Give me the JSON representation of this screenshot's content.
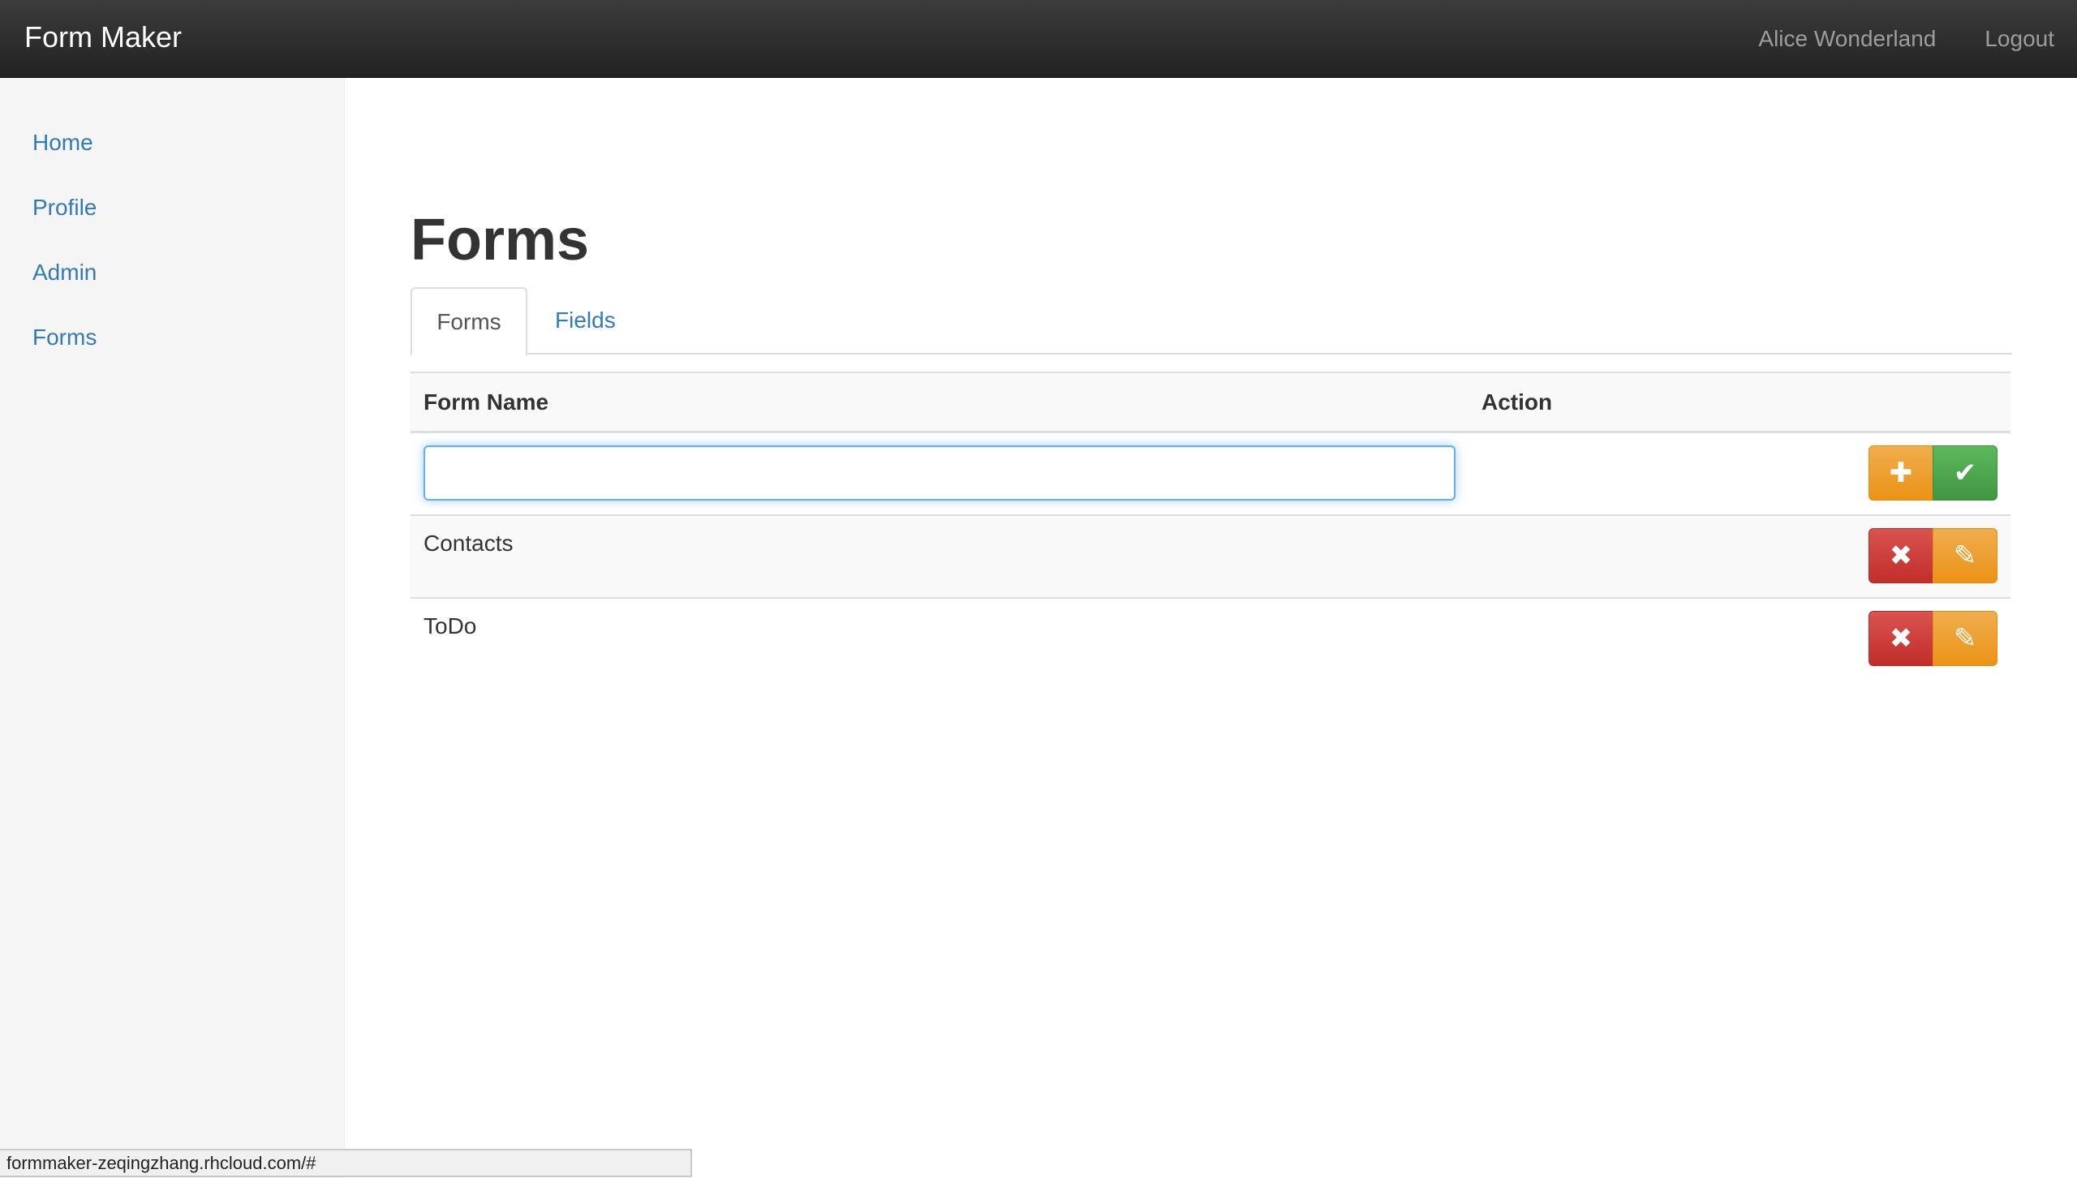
{
  "navbar": {
    "brand": "Form Maker",
    "user": "Alice Wonderland",
    "logout": "Logout"
  },
  "sidebar": {
    "items": [
      {
        "label": "Home"
      },
      {
        "label": "Profile"
      },
      {
        "label": "Admin"
      },
      {
        "label": "Forms"
      }
    ]
  },
  "main": {
    "title": "Forms",
    "tabs": [
      {
        "label": "Forms",
        "active": true
      },
      {
        "label": "Fields",
        "active": false
      }
    ],
    "table": {
      "headers": [
        "Form Name",
        "Action"
      ],
      "new_form_input": {
        "value": "",
        "placeholder": ""
      },
      "rows": [
        {
          "name": "Contacts"
        },
        {
          "name": "ToDo"
        }
      ]
    }
  },
  "icons": {
    "add": "plus-icon",
    "confirm": "check-icon",
    "delete": "x-icon",
    "edit": "pencil-icon"
  },
  "colors": {
    "link": "#337ab7",
    "warning": "#f0ad4e",
    "success": "#5cb85c",
    "danger": "#d9534f",
    "navbar": "#222222"
  },
  "statusbar": {
    "url": "formmaker-zeqingzhang.rhcloud.com/#"
  }
}
